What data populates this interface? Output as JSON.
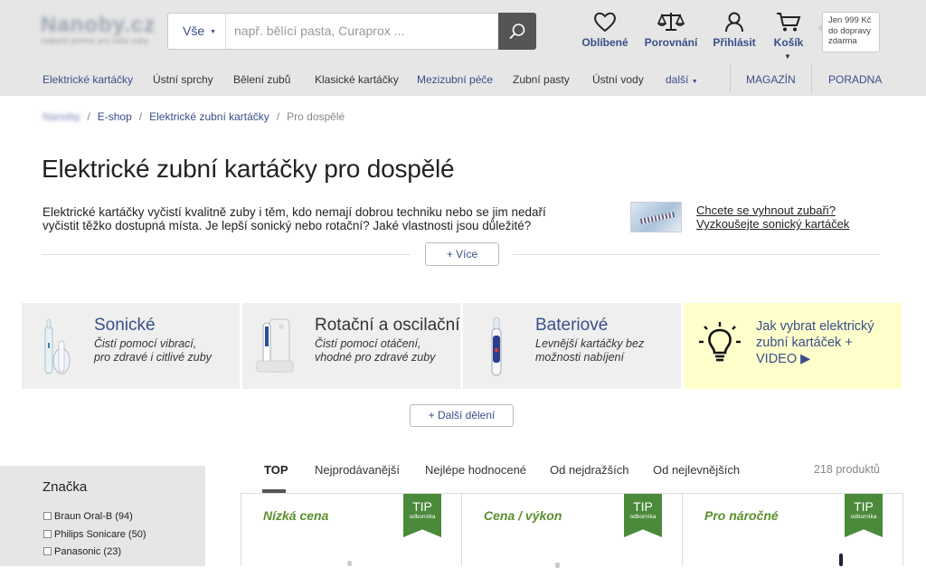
{
  "header": {
    "logo_text": "Nanoby.cz",
    "logo_tagline": "nejlepší pomoc pro vaše zuby",
    "search": {
      "category": "Vše",
      "placeholder": "např. bělící pasta, Curaprox ..."
    },
    "icons": [
      {
        "label": "Oblíbené",
        "icon": "heart-icon"
      },
      {
        "label": "Porovnání",
        "icon": "scales-icon"
      },
      {
        "label": "Přihlásit",
        "icon": "user-icon"
      },
      {
        "label": "Košík",
        "icon": "cart-icon"
      }
    ],
    "free_shipping": "Jen 999 Kč do dopravy zdarma"
  },
  "nav": {
    "items": [
      "Elektrické kartáčky",
      "Ústní sprchy",
      "Bělení zubů",
      "Klasické kartáčky",
      "Mezizubní péče",
      "Zubní pasty",
      "Ústní vody",
      "další"
    ],
    "right": [
      "MAGAZÍN",
      "PORADNA"
    ]
  },
  "breadcrumb": [
    "Nanoby",
    "E-shop",
    "Elektrické zubní kartáčky",
    "Pro dospělé"
  ],
  "page": {
    "title": "Elektrické zubní kartáčky pro dospělé",
    "intro": "Elektrické kartáčky vyčistí kvalitně zuby i těm, kdo nemají dobrou techniku nebo se jim nedaří vyčistit těžko dostupná místa. Je lepší sonický nebo rotační? Jaké vlastnosti jsou důležité?",
    "promo_line1": "Chcete se vyhnout zubaři?",
    "promo_line2": "Vyzkoušejte sonický kartáček",
    "more_button": "+ Více"
  },
  "categories": [
    {
      "title": "Sonické",
      "desc1": "Čistí pomocí vibrací,",
      "desc2": "pro zdravé i citlivé zuby"
    },
    {
      "title": "Rotační a oscilační",
      "desc1": "Čistí pomocí otáčení,",
      "desc2": "vhodné pro zdravé zuby"
    },
    {
      "title": "Bateriové",
      "desc1": "Levnější kartáčky bez",
      "desc2": "možnosti nabíjení"
    }
  ],
  "guide": {
    "line1": "Jak vybrat elektrický",
    "line2": "zubní kartáček +",
    "line3": "VIDEO ▶"
  },
  "more_divisions": "+ Další dělení",
  "sidebar": {
    "heading": "Značka",
    "brands": [
      "Braun Oral-B (94)",
      "Philips Sonicare (50)",
      "Panasonic (23)"
    ]
  },
  "sort": {
    "tabs": [
      "TOP",
      "Nejprodávanější",
      "Nejlépe hodnocené",
      "Od nejdražších",
      "Od nejlevnějších"
    ],
    "active": "TOP",
    "count": "218 produktů"
  },
  "products": [
    {
      "label": "Nízká cena",
      "tip": "TIP",
      "tip_sub": "odborníka"
    },
    {
      "label": "Cena / výkon",
      "tip": "TIP",
      "tip_sub": "odborníka"
    },
    {
      "label": "Pro náročné",
      "tip": "TIP",
      "tip_sub": "odborníka"
    }
  ],
  "colors": {
    "link": "#3a4e8a",
    "header_bg": "#e6e6e6",
    "tip_green": "#4a8a3a",
    "guide_bg": "#ffffcc"
  }
}
